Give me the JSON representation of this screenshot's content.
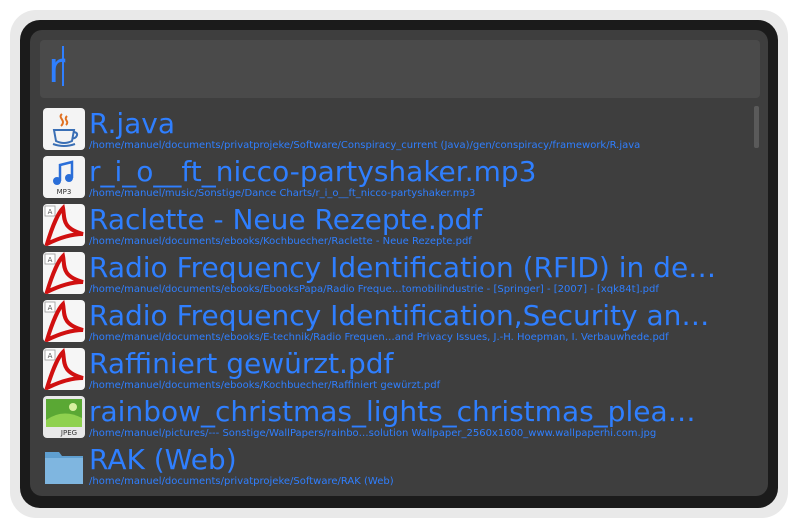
{
  "search": {
    "query": "r"
  },
  "results": [
    {
      "title": "R.java",
      "path": "/home/manuel/documents/privatprojeke/Software/Conspiracy_current (Java)/gen/conspiracy/framework/R.java",
      "icon": "java-file-icon"
    },
    {
      "title": "r_i_o__ft_nicco-partyshaker.mp3",
      "path": "/home/manuel/music/Sonstige/Dance Charts/r_i_o__ft_nicco-partyshaker.mp3",
      "icon": "mp3-file-icon",
      "icon_label": "MP3"
    },
    {
      "title": "Raclette - Neue Rezepte.pdf",
      "path": "/home/manuel/documents/ebooks/Kochbuecher/Raclette - Neue Rezepte.pdf",
      "icon": "pdf-file-icon"
    },
    {
      "title": "Radio Frequency Identification (RFID) in de…",
      "path": "/home/manuel/documents/ebooks/EbooksPapa/Radio Freque…tomobilindustrie - [Springer] - [2007] - [xqk84t].pdf",
      "icon": "pdf-file-icon"
    },
    {
      "title": "Radio Frequency Identification,Security an…",
      "path": "/home/manuel/documents/ebooks/E-technik/Radio Frequen…and Privacy Issues, J.-H. Hoepman, I. Verbauwhede.pdf",
      "icon": "pdf-file-icon"
    },
    {
      "title": "Raffiniert gewürzt.pdf",
      "path": "/home/manuel/documents/ebooks/Kochbuecher/Raffiniert gewürzt.pdf",
      "icon": "pdf-file-icon"
    },
    {
      "title": "rainbow_christmas_lights_christmas_plea…",
      "path": "/home/manuel/pictures/--- Sonstige/WallPapers/rainbo…solution Wallpaper_2560x1600_www.wallpaperhi.com.jpg",
      "icon": "jpeg-file-icon",
      "icon_label": "JPEG"
    },
    {
      "title": "RAK (Web)",
      "path": "/home/manuel/documents/privatprojeke/Software/RAK (Web)",
      "icon": "folder-icon"
    }
  ],
  "colors": {
    "accent": "#2f7fff",
    "panel": "#3e3e3e",
    "frame": "#1b1b1b"
  }
}
